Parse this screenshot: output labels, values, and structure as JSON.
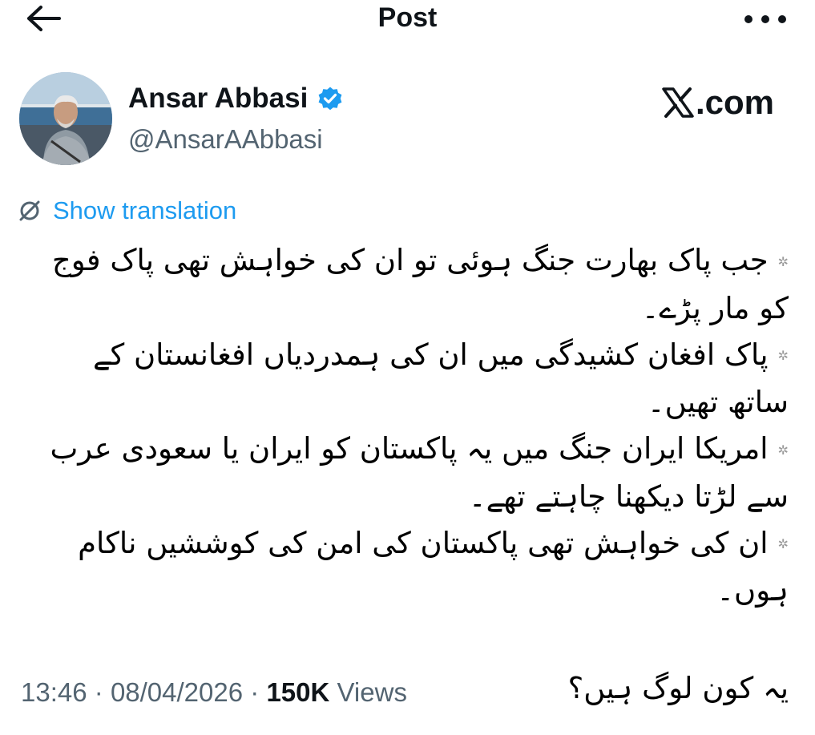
{
  "header": {
    "title": "Post"
  },
  "author": {
    "name": "Ansar Abbasi",
    "handle": "@AnsarAAbbasi",
    "verified": true
  },
  "brand": {
    "label": ".com",
    "icon": "x-logo-icon"
  },
  "translation": {
    "label": "Show translation",
    "icon": "globe-icon"
  },
  "post": {
    "lines": [
      "جب پاک بھارت جنگ ہوئی تو ان کی خواہش تھی پاک فوج کو مار پڑے۔",
      "پاک افغان کشیدگی میں ان کی ہمدردیاں افغانستان کے ساتھ تھیں۔",
      "امریکا ایران جنگ میں یہ پاکستان کو ایران یا سعودی عرب سے لڑتا دیکھنا چاہتے تھے۔",
      "ان کی خواہش تھی پاکستان کی امن کی کوششیں ناکام ہوں۔"
    ],
    "closing": "یہ کون لوگ ہیں؟",
    "bullet": "✲"
  },
  "meta": {
    "time": "13:46",
    "date": "08/04/2026",
    "views_count": "150K",
    "views_label": "Views",
    "separator": "·"
  },
  "colors": {
    "link": "#1d9bf0",
    "muted": "#536471",
    "text": "#0f1419",
    "verified": "#1d9bf0"
  }
}
